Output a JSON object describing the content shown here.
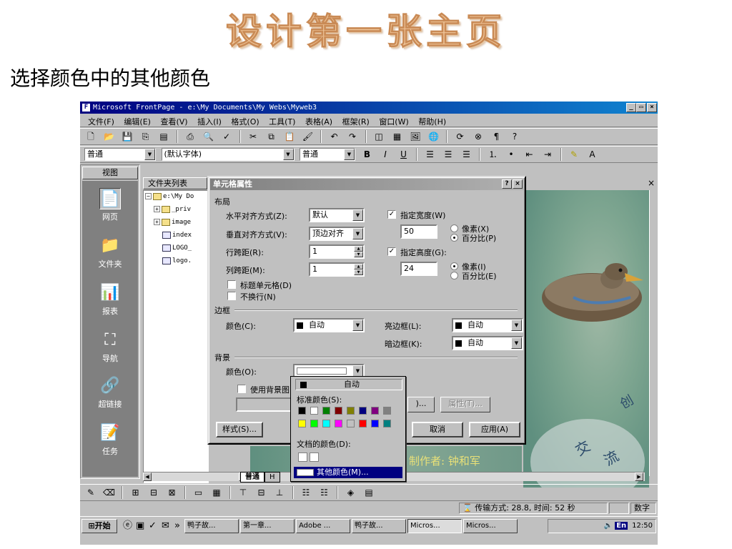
{
  "slide": {
    "title": "设计第一张主页",
    "subtitle": "选择颜色中的其他颜色"
  },
  "window": {
    "title": "Microsoft FrontPage - e:\\My Documents\\My Webs\\Myweb3",
    "min_label": "_",
    "max_label": "▭",
    "close_label": "×"
  },
  "menubar": {
    "items": [
      "文件(F)",
      "编辑(E)",
      "查看(V)",
      "插入(I)",
      "格式(O)",
      "工具(T)",
      "表格(A)",
      "框架(R)",
      "窗口(W)",
      "帮助(H)"
    ]
  },
  "format_toolbar": {
    "style_value": "普通",
    "font_value": "(默认字体)",
    "size_value": "普通",
    "bold": "B",
    "italic": "I",
    "underline": "U"
  },
  "views": {
    "header": "视图",
    "items": [
      "网页",
      "文件夹",
      "报表",
      "导航",
      "超链接",
      "任务"
    ]
  },
  "folder_list": {
    "header": "文件夹列表",
    "items": [
      "e:\\My Do",
      "_priv",
      "image",
      "index",
      "LOGO_",
      "logo."
    ]
  },
  "page_tabs": {
    "normal": "普通",
    "html": "H"
  },
  "page_text": "制作者: 钟和军",
  "dialog": {
    "title": "单元格属性",
    "help_label": "?",
    "close_label": "×",
    "layout_section": "布局",
    "halign_label": "水平对齐方式(Z):",
    "halign_value": "默认",
    "valign_label": "垂直对齐方式(V):",
    "valign_value": "顶边对齐",
    "rowspan_label": "行跨距(R):",
    "rowspan_value": "1",
    "colspan_label": "列跨距(M):",
    "colspan_value": "1",
    "header_cell_label": "标题单元格(D)",
    "nowrap_label": "不换行(N)",
    "spec_width_label": "指定宽度(W)",
    "width_value": "50",
    "px_w_label": "像素(X)",
    "pct_w_label": "百分比(P)",
    "spec_height_label": "指定高度(G):",
    "height_value": "24",
    "px_h_label": "像素(I)",
    "pct_h_label": "百分比(E)",
    "border_section": "边框",
    "border_color_label": "颜色(C):",
    "border_color_value": "自动",
    "light_border_label": "亮边框(L):",
    "light_border_value": "自动",
    "dark_border_label": "暗边框(K):",
    "dark_border_value": "自动",
    "bg_section": "背景",
    "bg_color_label": "颜色(O):",
    "use_bg_image_label": "使用背景图",
    "browse_label": ")...",
    "properties_label": "属性(T)...",
    "style_button": "样式(S)...",
    "cancel_button": "取消",
    "apply_button": "应用(A)"
  },
  "color_popup": {
    "auto_label": "自动",
    "standard_label": "标准颜色(S):",
    "standard_colors": [
      "#000000",
      "#ffffff",
      "#008000",
      "#800000",
      "#808000",
      "#000080",
      "#800080",
      "#808080",
      "#ffff00",
      "#00ff00",
      "#00ffff",
      "#ff00ff",
      "#c0c0c0",
      "#ff0000",
      "#0000ff",
      "#008080"
    ],
    "document_label": "文档的颜色(D):",
    "more_label": "其他颜色(M)..."
  },
  "statusbar": {
    "transfer": "传输方式: 28.8, 时间: 52 秒",
    "mode": "数字"
  },
  "taskbar": {
    "start": "开始",
    "quick_more": "»",
    "tasks": [
      "鸭子故...",
      "第一章...",
      "Adobe ...",
      "鸭子故...",
      "Micros...",
      "Micros..."
    ],
    "lang": "En",
    "clock": "12:50"
  },
  "colors": {
    "title_bar": "#000080",
    "dialog_title": "#808080",
    "face": "#c0c0c0",
    "slide_title": "#f0c69a"
  }
}
